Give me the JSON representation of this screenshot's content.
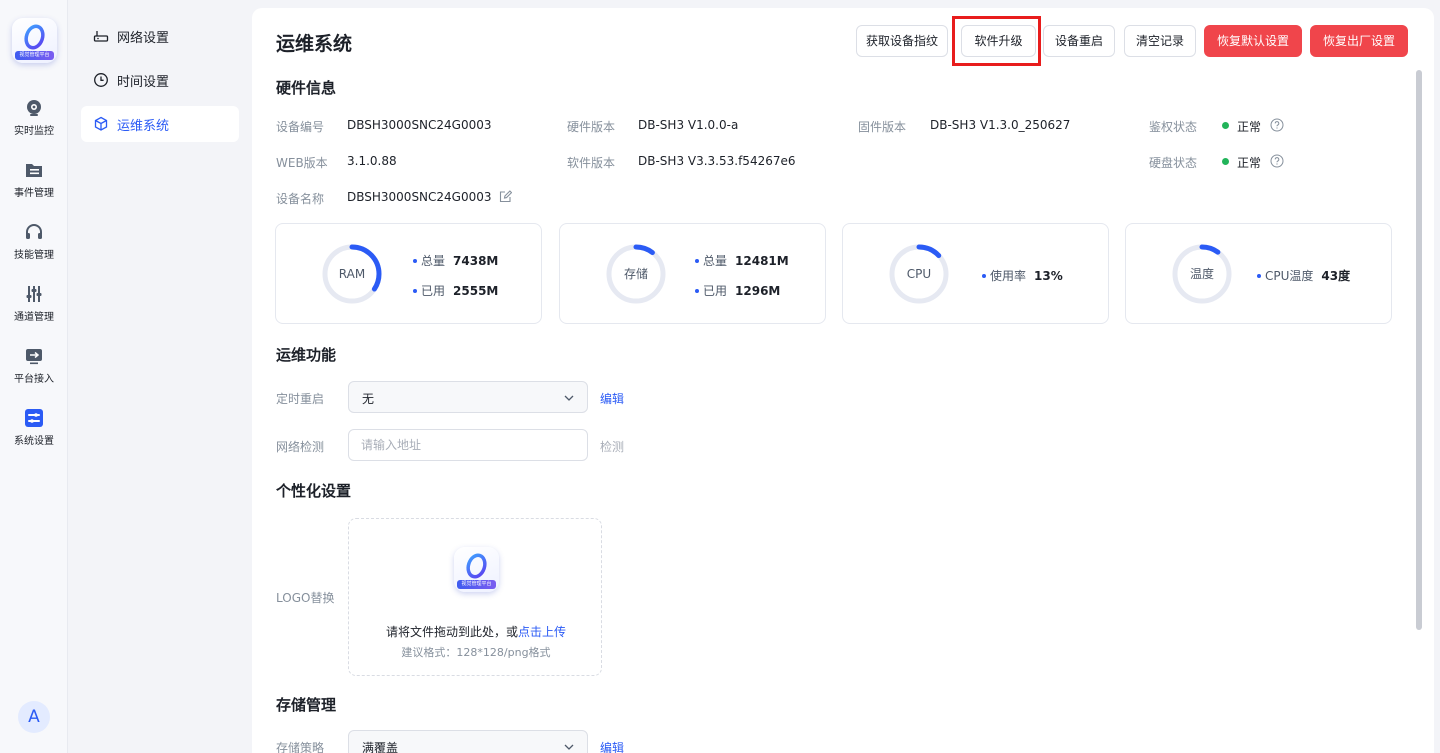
{
  "app": {
    "logo_text": "视觉管理平台"
  },
  "rail": {
    "items": [
      {
        "label": "实时监控",
        "icon": "camera-icon"
      },
      {
        "label": "事件管理",
        "icon": "folder-list-icon"
      },
      {
        "label": "技能管理",
        "icon": "headset-icon"
      },
      {
        "label": "通道管理",
        "icon": "sliders-icon"
      },
      {
        "label": "平台接入",
        "icon": "arrow-box-icon"
      },
      {
        "label": "系统设置",
        "icon": "settings-toggle-icon"
      }
    ],
    "avatar": "A"
  },
  "subnav": {
    "items": [
      {
        "label": "网络设置",
        "icon": "router-icon"
      },
      {
        "label": "时间设置",
        "icon": "clock-icon"
      },
      {
        "label": "运维系统",
        "icon": "cube-icon",
        "active": true
      }
    ]
  },
  "header": {
    "title": "运维系统",
    "buttons": {
      "fingerprint": "获取设备指纹",
      "upgrade": "软件升级",
      "reboot": "设备重启",
      "clear": "清空记录",
      "restore_default": "恢复默认设置",
      "factory_reset": "恢复出厂设置"
    }
  },
  "hardware": {
    "title": "硬件信息",
    "device_no_label": "设备编号",
    "device_no": "DBSH3000SNC24G0003",
    "hw_version_label": "硬件版本",
    "hw_version": "DB-SH3 V1.0.0-a",
    "fw_version_label": "固件版本",
    "fw_version": "DB-SH3 V1.3.0_250627",
    "auth_label": "鉴权状态",
    "auth_status": "正常",
    "web_version_label": "WEB版本",
    "web_version": "3.1.0.88",
    "sw_version_label": "软件版本",
    "sw_version": "DB-SH3 V3.3.53.f54267e6",
    "disk_label": "硬盘状态",
    "disk_status": "正常",
    "device_name_label": "设备名称",
    "device_name": "DBSH3000SNC24G0003",
    "status_color": "#22b45a"
  },
  "resources": {
    "ram": {
      "label": "RAM",
      "total_label": "总量",
      "total": "7438M",
      "used_label": "已用",
      "used": "2555M",
      "fraction": 0.3435
    },
    "storage": {
      "label": "存储",
      "total_label": "总量",
      "total": "12481M",
      "used_label": "已用",
      "used": "1296M",
      "fraction": 0.1038
    },
    "cpu": {
      "label": "CPU",
      "usage_label": "使用率",
      "usage": "13%",
      "fraction": 0.13
    },
    "temp": {
      "label": "温度",
      "temp_label": "CPU温度",
      "temp": "43度",
      "fraction": 0.1
    },
    "accent_color": "#2b5bf5",
    "track_color": "#e6e9f2"
  },
  "ops": {
    "title": "运维功能",
    "reboot_label": "定时重启",
    "reboot_value": "无",
    "edit": "编辑",
    "net_label": "网络检测",
    "net_placeholder": "请输入地址",
    "detect": "检测"
  },
  "personal": {
    "title": "个性化设置",
    "logo_label": "LOGO替换",
    "upload_text": "请将文件拖动到此处，或",
    "upload_link": "点击上传",
    "upload_hint": "建议格式：128*128/png格式"
  },
  "storage_mgmt": {
    "title": "存储管理",
    "policy_label": "存储策略",
    "policy_value": "满覆盖",
    "edit": "编辑"
  },
  "colors": {
    "primary": "#2b5bf5",
    "danger": "#f0454b",
    "highlight": "#e81c1c"
  }
}
